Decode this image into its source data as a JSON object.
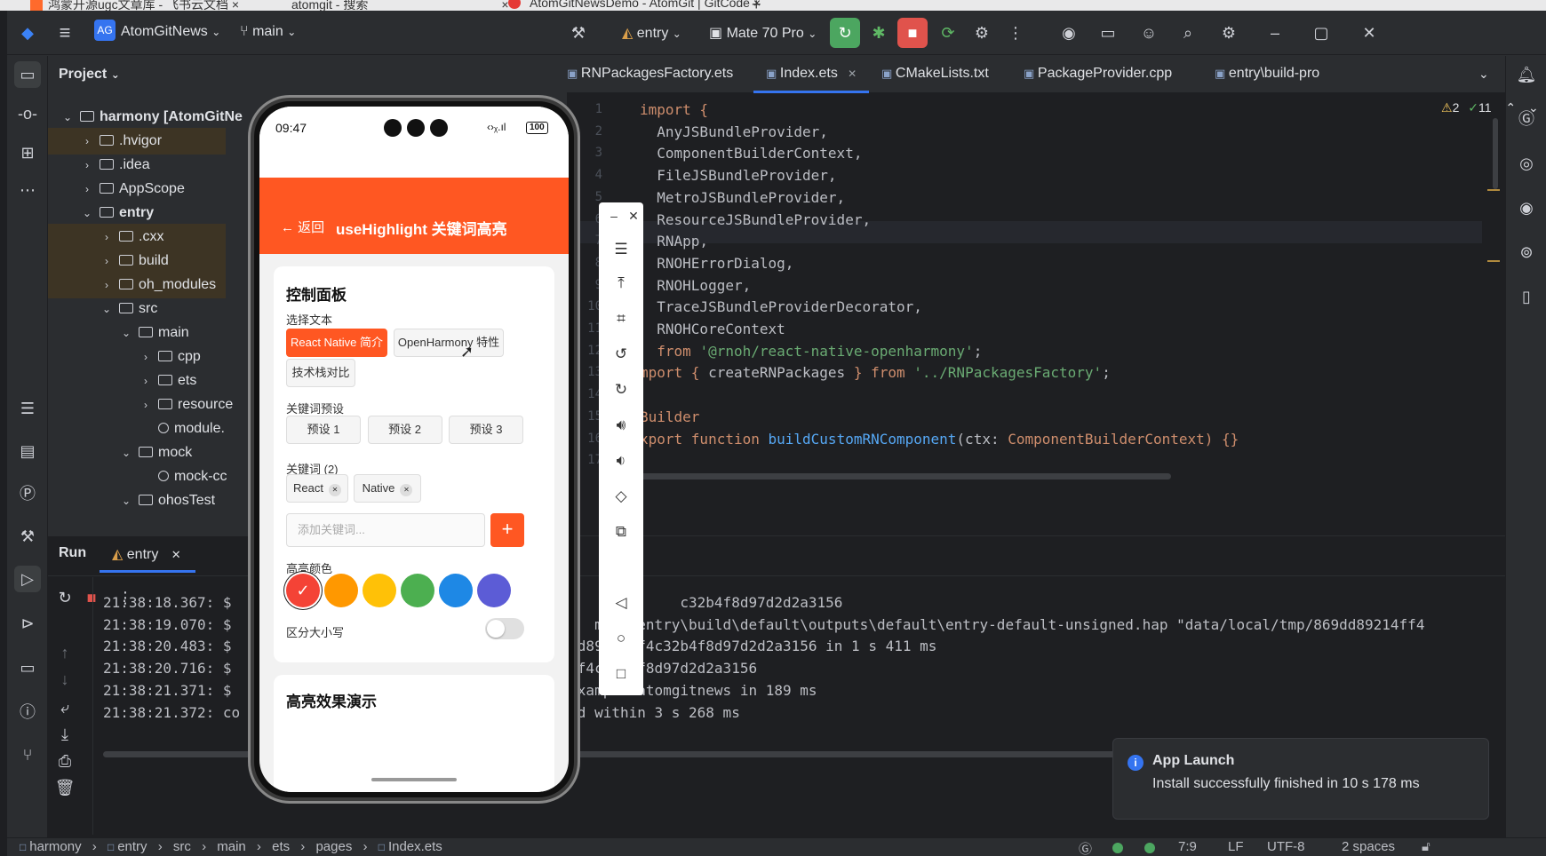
{
  "browser_tabs": [
    {
      "label": "鸿蒙开源ugc文章库 - 飞书云文档"
    },
    {
      "label": "atomgit - 搜索"
    },
    {
      "label": "AtomGitNewsDemo - AtomGit | GitCode"
    }
  ],
  "titlebar": {
    "project_badge": "AG",
    "project_name": "AtomGitNews",
    "branch": "main",
    "run_config": "entry",
    "device": "Mate 70 Pro"
  },
  "project_pane": {
    "title": "Project",
    "tree": [
      {
        "label": "harmony [AtomGitNe",
        "bold": true,
        "depth": 0,
        "chev": "v",
        "excluded": false
      },
      {
        "label": ".hvigor",
        "depth": 1,
        "chev": ">",
        "excluded": true
      },
      {
        "label": ".idea",
        "depth": 1,
        "chev": ">",
        "excluded": false
      },
      {
        "label": "AppScope",
        "depth": 1,
        "chev": ">",
        "excluded": false
      },
      {
        "label": "entry",
        "bold": true,
        "depth": 1,
        "chev": "v",
        "excluded": false
      },
      {
        "label": ".cxx",
        "depth": 2,
        "chev": ">",
        "excluded": true
      },
      {
        "label": "build",
        "depth": 2,
        "chev": ">",
        "excluded": true
      },
      {
        "label": "oh_modules",
        "depth": 2,
        "chev": ">",
        "excluded": true
      },
      {
        "label": "src",
        "depth": 2,
        "chev": "v",
        "excluded": false
      },
      {
        "label": "main",
        "depth": 3,
        "chev": "v",
        "excluded": false
      },
      {
        "label": "cpp",
        "depth": 4,
        "chev": ">",
        "excluded": false
      },
      {
        "label": "ets",
        "depth": 4,
        "chev": ">",
        "excluded": false
      },
      {
        "label": "resource",
        "depth": 4,
        "chev": ">",
        "excluded": false
      },
      {
        "label": "module.",
        "depth": 4,
        "chev": "",
        "excluded": false,
        "file": true
      },
      {
        "label": "mock",
        "depth": 3,
        "chev": "v",
        "excluded": false
      },
      {
        "label": "mock-cc",
        "depth": 4,
        "chev": "",
        "excluded": false,
        "file": true
      },
      {
        "label": "ohosTest",
        "depth": 3,
        "chev": "v",
        "excluded": false
      }
    ]
  },
  "editor": {
    "tabs": [
      "RNPackagesFactory.ets",
      "Index.ets",
      "CMakeLists.txt",
      "PackageProvider.cpp",
      "entry\\build-pro"
    ],
    "active_tab": 1,
    "inspections": {
      "warnings": "2",
      "ok": "11"
    },
    "line_numbers": [
      "1",
      "2",
      "3",
      "4",
      "5",
      "6",
      "7",
      "8",
      "9",
      "10",
      "11",
      "12",
      "13",
      "14",
      "15",
      "16",
      "17"
    ],
    "code": [
      [
        {
          "t": "import {",
          "c": "kw"
        }
      ],
      [
        {
          "t": "  AnyJSBundleProvider,",
          "c": ""
        }
      ],
      [
        {
          "t": "  ComponentBuilderContext,",
          "c": ""
        }
      ],
      [
        {
          "t": "  FileJSBundleProvider,",
          "c": ""
        }
      ],
      [
        {
          "t": "  MetroJSBundleProvider,",
          "c": ""
        }
      ],
      [
        {
          "t": "  ResourceJSBundleProvider,",
          "c": ""
        }
      ],
      [
        {
          "t": "  RNApp,",
          "c": ""
        }
      ],
      [
        {
          "t": "  RNOHErrorDialog,",
          "c": ""
        }
      ],
      [
        {
          "t": "  RNOHLogger,",
          "c": ""
        }
      ],
      [
        {
          "t": "  TraceJSBundleProviderDecorator,",
          "c": ""
        }
      ],
      [
        {
          "t": "  RNOHCoreContext",
          "c": ""
        }
      ],
      [
        {
          "t": "  from ",
          "c": "kw"
        },
        {
          "t": "'@rnoh/react-native-openharmony'",
          "c": "str"
        },
        {
          "t": ";",
          "c": ""
        }
      ],
      [
        {
          "t": "mport { ",
          "c": "kw"
        },
        {
          "t": "createRNPackages ",
          "c": ""
        },
        {
          "t": "} from ",
          "c": "kw"
        },
        {
          "t": "'../RNPackagesFactory'",
          "c": "str"
        },
        {
          "t": ";",
          "c": ""
        }
      ],
      [
        {
          "t": "",
          "c": ""
        }
      ],
      [
        {
          "t": "Builder",
          "c": "kw"
        }
      ],
      [
        {
          "t": "xport function ",
          "c": "kw"
        },
        {
          "t": "buildCustomRNComponent",
          "c": "fn"
        },
        {
          "t": "(ctx: ",
          "c": ""
        },
        {
          "t": "ComponentBuilderContext",
          "c": "kw"
        },
        {
          "t": ") {}",
          "c": "kw"
        }
      ],
      [
        {
          "t": "",
          "c": ""
        }
      ]
    ]
  },
  "run_panel": {
    "title": "Run",
    "tab": "entry",
    "log_times": [
      "21:38:18.367: $",
      "21:38:19.070: $",
      "21:38:20.483: $",
      "21:38:20.716: $",
      "21:38:21.371: $",
      "21:38:21.372: co"
    ],
    "log_right": [
      "92                c32b4f8d97d2d2a3156",
      "ews     mony\\entry\\build\\default\\outputs\\default\\entry-default-unsigned.hap \"data/local/tmp/869dd89214ff4",
      "p/869dd89214ff4c32b4f8d97d2d2a3156 in 1 s 411 ms",
      "89214ff4c32b4f8d97d2d2a3156",
      " com.example.atomgitnews in 189 ms",
      "aunched within 3 s 268 ms"
    ]
  },
  "toast": {
    "title": "App Launch",
    "message": "Install successfully finished in 10 s 178 ms"
  },
  "statusbar": {
    "breadcrumb": [
      "harmony",
      "entry",
      "src",
      "main",
      "ets",
      "pages",
      "Index.ets"
    ],
    "position": "7:9",
    "line_sep": "LF",
    "encoding": "UTF-8",
    "indent": "2 spaces"
  },
  "phone": {
    "time": "09:47",
    "battery": "100",
    "back_label": "← 返回",
    "page_title": "useHighlight 关键词高亮",
    "control_title": "控制面板",
    "select_text_label": "选择文本",
    "text_options": [
      "React Native 简介",
      "OpenHarmony 特性",
      "技术栈对比"
    ],
    "selected_text_option": 0,
    "preset_label": "关键词预设",
    "presets": [
      "预设 1",
      "预设 2",
      "预设 3"
    ],
    "keywords_label": "关键词 (2)",
    "keywords": [
      "React",
      "Native"
    ],
    "add_placeholder": "添加关键词...",
    "add_button": "+",
    "color_label": "高亮颜色",
    "colors": [
      "#f44336",
      "#ff9800",
      "#ffc107",
      "#4caf50",
      "#1e88e5",
      "#5c5cd6"
    ],
    "selected_color": 0,
    "case_label": "区分大小写",
    "case_sensitive": false,
    "demo_title": "高亮效果演示"
  }
}
